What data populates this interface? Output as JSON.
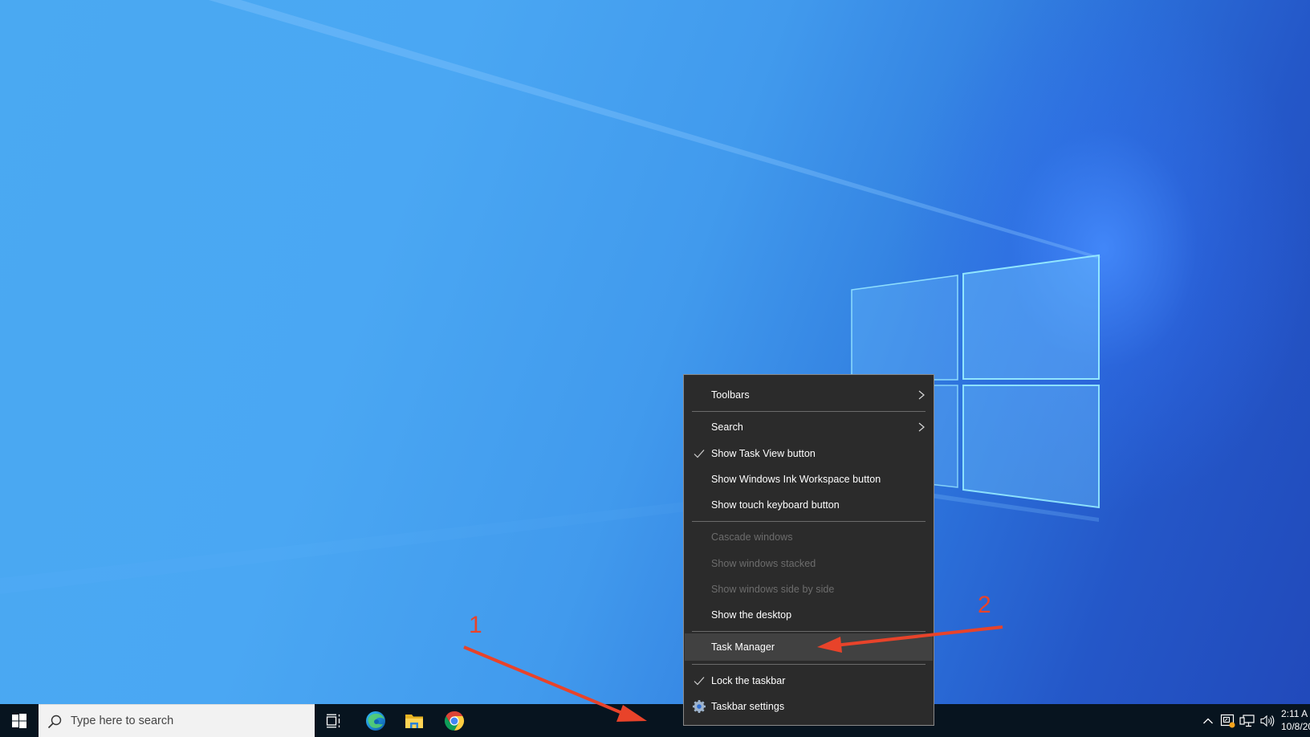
{
  "desktop": {
    "wallpaper": "Windows 10 default (Windows logo light)"
  },
  "context_menu": {
    "items": [
      {
        "label": "Toolbars",
        "submenu": true,
        "checked": false,
        "enabled": true
      },
      {
        "label": "Search",
        "submenu": true,
        "checked": false,
        "enabled": true
      },
      {
        "label": "Show Task View button",
        "submenu": false,
        "checked": true,
        "enabled": true
      },
      {
        "label": "Show Windows Ink Workspace button",
        "submenu": false,
        "checked": false,
        "enabled": true
      },
      {
        "label": "Show touch keyboard button",
        "submenu": false,
        "checked": false,
        "enabled": true
      },
      {
        "label": "Cascade windows",
        "submenu": false,
        "checked": false,
        "enabled": false
      },
      {
        "label": "Show windows stacked",
        "submenu": false,
        "checked": false,
        "enabled": false
      },
      {
        "label": "Show windows side by side",
        "submenu": false,
        "checked": false,
        "enabled": false
      },
      {
        "label": "Show the desktop",
        "submenu": false,
        "checked": false,
        "enabled": true
      },
      {
        "label": "Task Manager",
        "submenu": false,
        "checked": false,
        "enabled": true,
        "highlighted": true
      },
      {
        "label": "Lock the taskbar",
        "submenu": false,
        "checked": true,
        "enabled": true
      },
      {
        "label": "Taskbar settings",
        "submenu": false,
        "checked": false,
        "enabled": true,
        "icon": "gear-icon"
      }
    ]
  },
  "taskbar": {
    "start_icon": "windows-logo-icon",
    "search": {
      "placeholder": "Type here to search",
      "icon": "search-icon"
    },
    "pinned": [
      {
        "name": "Task View",
        "icon": "task-view-icon"
      },
      {
        "name": "Microsoft Edge",
        "icon": "edge-icon"
      },
      {
        "name": "File Explorer",
        "icon": "file-explorer-icon"
      },
      {
        "name": "Google Chrome",
        "icon": "chrome-icon"
      }
    ],
    "tray": {
      "icons": [
        "chevron-up-icon",
        "meet-now-icon",
        "network-icon",
        "volume-icon"
      ],
      "time": "2:11 A",
      "date": "10/8/20"
    }
  },
  "annotations": {
    "step1": "1",
    "step2": "2",
    "color": "#e8432a"
  }
}
